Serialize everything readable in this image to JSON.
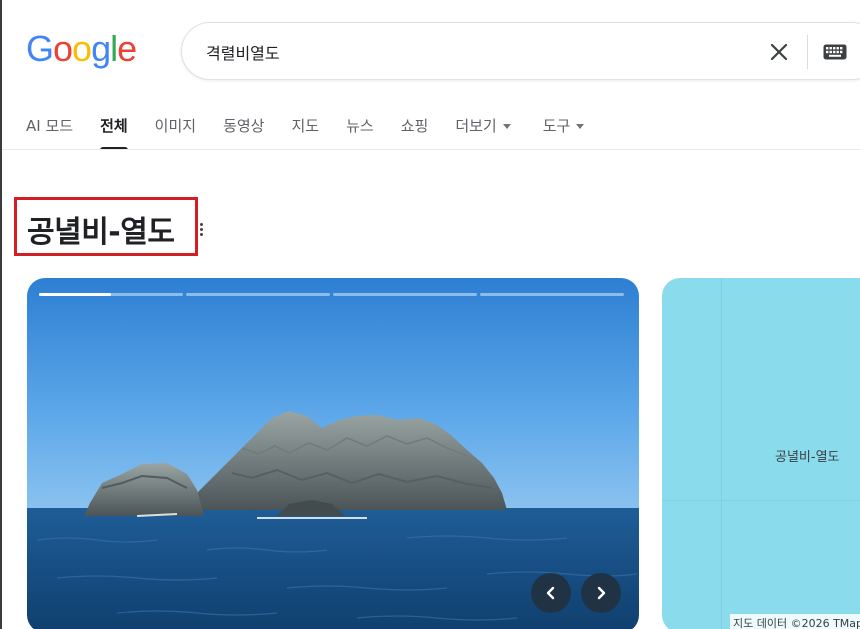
{
  "logo": {
    "letters": [
      "G",
      "o",
      "o",
      "g",
      "l",
      "e"
    ],
    "colors": [
      "#4285f4",
      "#ea4335",
      "#fbbc05",
      "#4285f4",
      "#34a853",
      "#ea4335"
    ]
  },
  "search": {
    "query": "격렬비열도"
  },
  "tabs": [
    {
      "label": "AI 모드",
      "active": false
    },
    {
      "label": "전체",
      "active": true
    },
    {
      "label": "이미지",
      "active": false
    },
    {
      "label": "동영상",
      "active": false
    },
    {
      "label": "지도",
      "active": false
    },
    {
      "label": "뉴스",
      "active": false
    },
    {
      "label": "쇼핑",
      "active": false
    },
    {
      "label": "더보기",
      "active": false,
      "dropdown": true
    },
    {
      "label": "도구",
      "active": false,
      "dropdown": true
    }
  ],
  "entity": {
    "title": "공녈비-열도",
    "highlight_color": "#d21f26"
  },
  "photo": {
    "slides_total": 4,
    "current_slide_progress": 0.5,
    "icons": {
      "prev": "chevron-left-icon",
      "next": "chevron-right-icon"
    }
  },
  "map": {
    "label": "공녈비-열도",
    "attribution": "지도 데이터 ©2026 TMap"
  },
  "colors": {
    "accent": "#202124",
    "tab_inactive": "#5f6368",
    "map_water": "#8adced"
  }
}
